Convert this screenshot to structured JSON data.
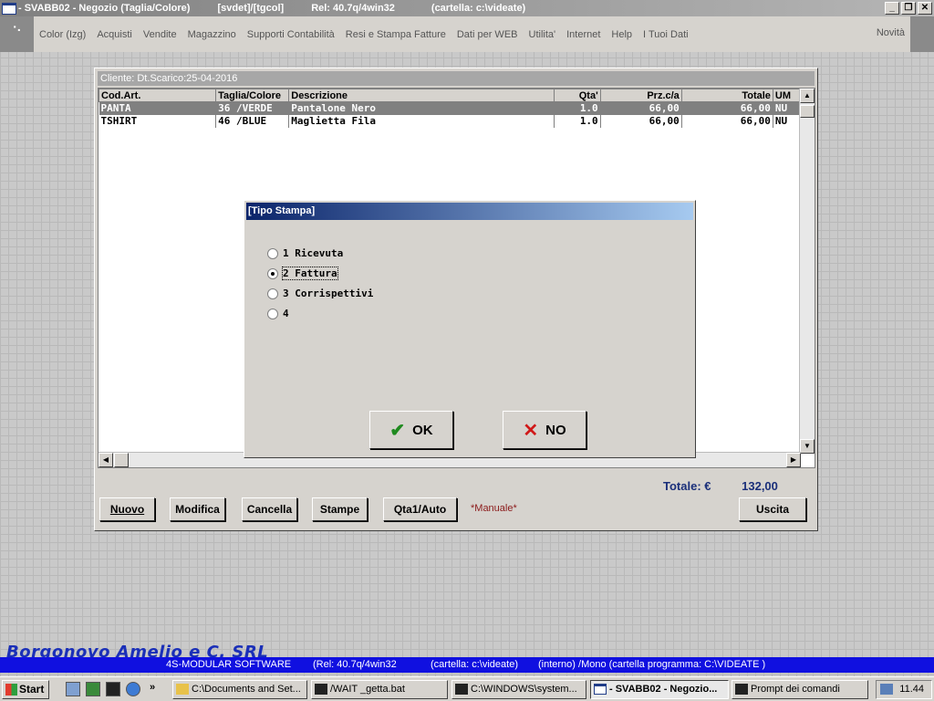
{
  "titlebar": {
    "app": "- SVABB02 - Negozio (Taglia/Colore)",
    "ctx": "[svdet]/[tgcol]",
    "rel": "Rel: 40.7q/4win32",
    "cartella": "(cartella: c:\\videate)"
  },
  "menu": {
    "items": [
      "Color (Izg)",
      "Acquisti",
      "Vendite",
      "Magazzino",
      "Supporti Contabilità",
      "Resi e Stampa Fatture",
      "Dati per WEB",
      "Utilita'",
      "Internet",
      "Help",
      "I Tuoi Dati"
    ],
    "novita": "Novità"
  },
  "window": {
    "cliente": "Cliente:  Dt.Scarico:25-04-2016",
    "columns": [
      "Cod.Art.",
      "Taglia/Colore",
      "Descrizione",
      "Qta'",
      "Prz.c/a",
      "Totale",
      "UM"
    ],
    "rows": [
      {
        "cod": "PANTA",
        "taglia": "36 /VERDE",
        "descr": "Pantalone Nero",
        "qta": "1.0",
        "prz": "66,00",
        "totale": "66,00",
        "um": "NU"
      },
      {
        "cod": "TSHIRT",
        "taglia": "46 /BLUE",
        "descr": "Maglietta Fila",
        "qta": "1.0",
        "prz": "66,00",
        "totale": "66,00",
        "um": "NU"
      }
    ],
    "totale_label": "Totale: €",
    "totale_value": "132,00",
    "buttons": {
      "nuovo": "Nuovo",
      "modifica": "Modifica",
      "cancella": "Cancella",
      "stampe": "Stampe",
      "qta": "Qta1/Auto",
      "uscita": "Uscita"
    },
    "manuale": "*Manuale*"
  },
  "dialog": {
    "title": "[Tipo Stampa]",
    "options": [
      "1 Ricevuta",
      "2 Fattura",
      "3 Corrispettivi",
      "4"
    ],
    "selected": "2 Fattura",
    "ok": "OK",
    "no": "NO"
  },
  "bottom": {
    "company": "Borgonovo Amelio e C. SRL",
    "status_software": "4S-MODULAR SOFTWARE",
    "status_rel": "(Rel: 40.7q/4win32",
    "status_cartella": "(cartella: c:\\videate)",
    "status_interno": "(interno)   /Mono   (cartella programma: C:\\VIDEATE )"
  },
  "taskbar": {
    "start": "Start",
    "tasks": [
      "C:\\Documents and Set...",
      "/WAIT _getta.bat",
      "C:\\WINDOWS\\system...",
      "- SVABB02 - Negozio...",
      "Prompt dei comandi"
    ],
    "clock": "11.44"
  },
  "colors": {
    "dialog_title_start": "#0a246a",
    "status_bar": "#1010e0",
    "company_text": "#1a2fb8"
  }
}
